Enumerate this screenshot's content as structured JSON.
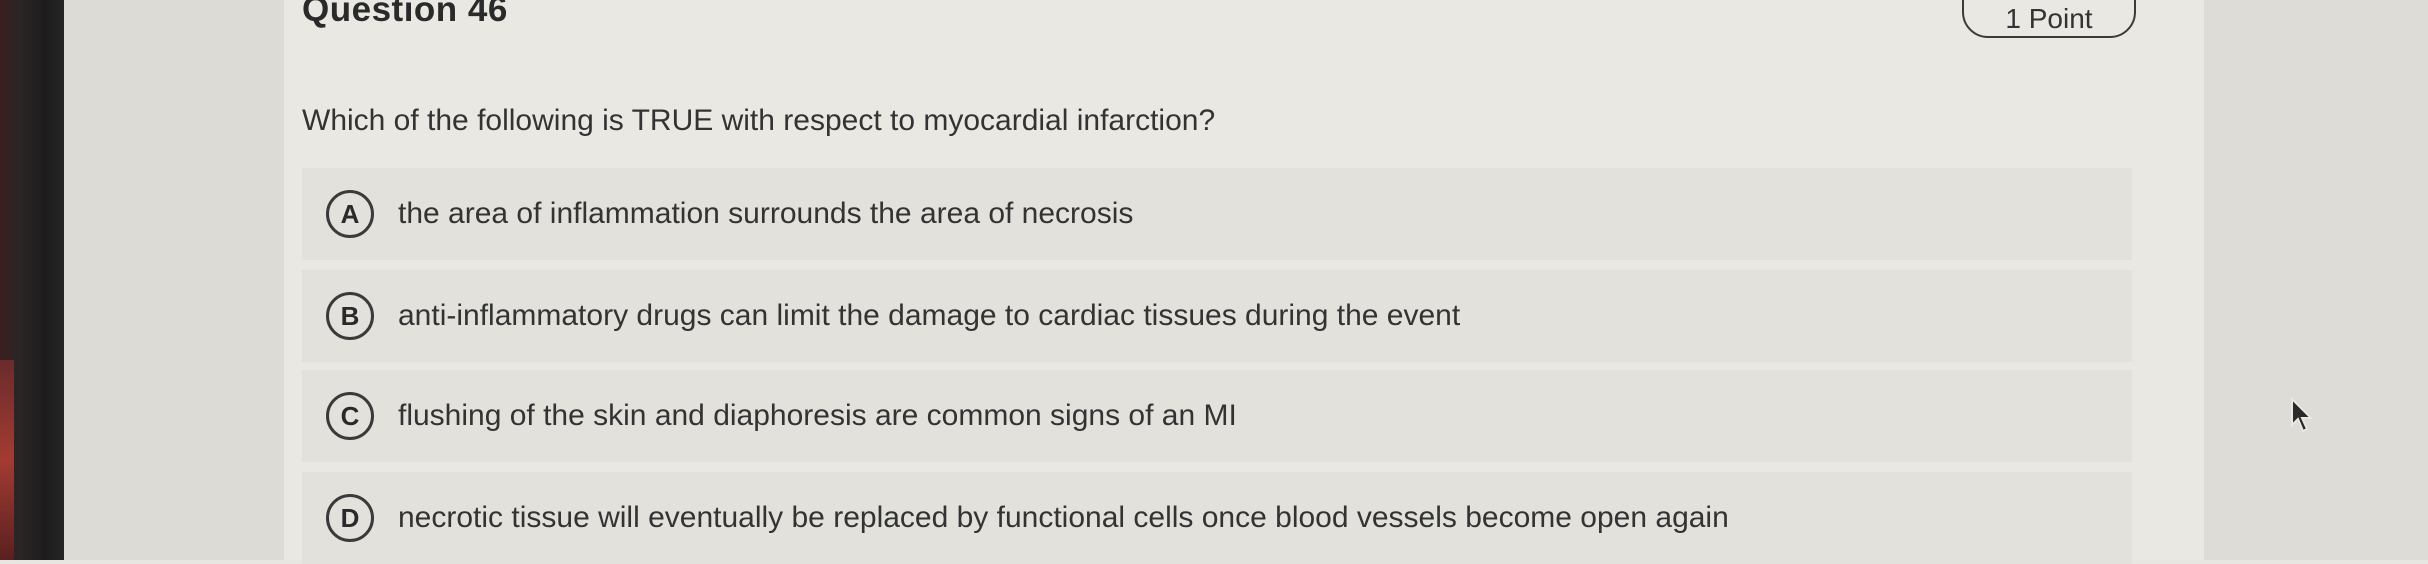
{
  "question": {
    "title": "Question 46",
    "points": "1 Point",
    "prompt": "Which of the following is TRUE with respect to myocardial infarction?",
    "options": [
      {
        "letter": "A",
        "text": "the area of inflammation surrounds the area of necrosis"
      },
      {
        "letter": "B",
        "text": "anti-inflammatory drugs can limit the damage to cardiac tissues during the event"
      },
      {
        "letter": "C",
        "text": "flushing of the skin and diaphoresis are common signs of an MI"
      },
      {
        "letter": "D",
        "text": "necrotic tissue will eventually be replaced by functional cells once blood vessels become open again"
      }
    ]
  },
  "icons": {
    "cursor": "mouse-pointer-icon"
  }
}
